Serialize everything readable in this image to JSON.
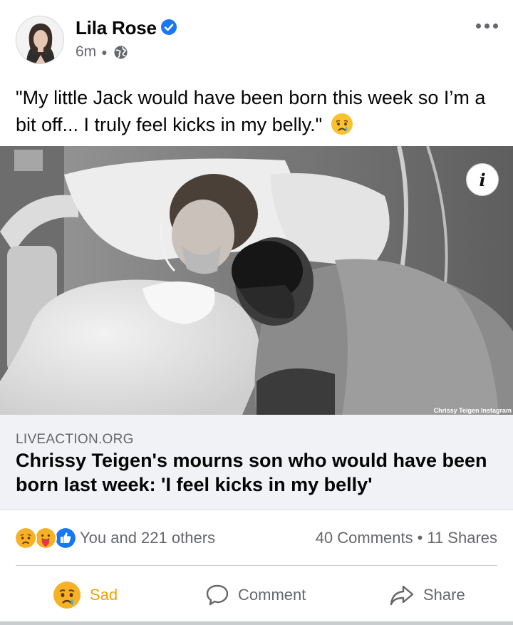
{
  "post": {
    "author": "Lila Rose",
    "time": "6m",
    "audience_icon": "globe-icon",
    "verified_icon": "verified-badge-icon",
    "more_icon": "more-options-icon",
    "caption": "\"My little Jack would have been born this week so I’m a bit off... I truly feel kicks in my belly.\"",
    "caption_emoji": "crying-face-emoji"
  },
  "photo": {
    "info_label": "i",
    "credit": "Chrissy Teigen Instagram"
  },
  "link_preview": {
    "domain": "LIVEACTION.ORG",
    "headline": "Chrissy Teigen's mourns son who would have been born last week: 'I feel kicks in my belly'"
  },
  "engagement": {
    "reaction_icons": [
      "sad-reaction-icon",
      "care-reaction-icon",
      "like-reaction-icon"
    ],
    "reactions_text": "You and 221 others",
    "comments": "40 Comments",
    "separator": "•",
    "shares": "11 Shares"
  },
  "actions": {
    "reaction_label": "Sad",
    "comment_label": "Comment",
    "share_label": "Share"
  },
  "colors": {
    "text_primary": "#050505",
    "text_secondary": "#65676b",
    "verified_blue": "#1877f2",
    "sad_yellow": "#f0a10d",
    "link_bg": "#f0f2f5"
  }
}
